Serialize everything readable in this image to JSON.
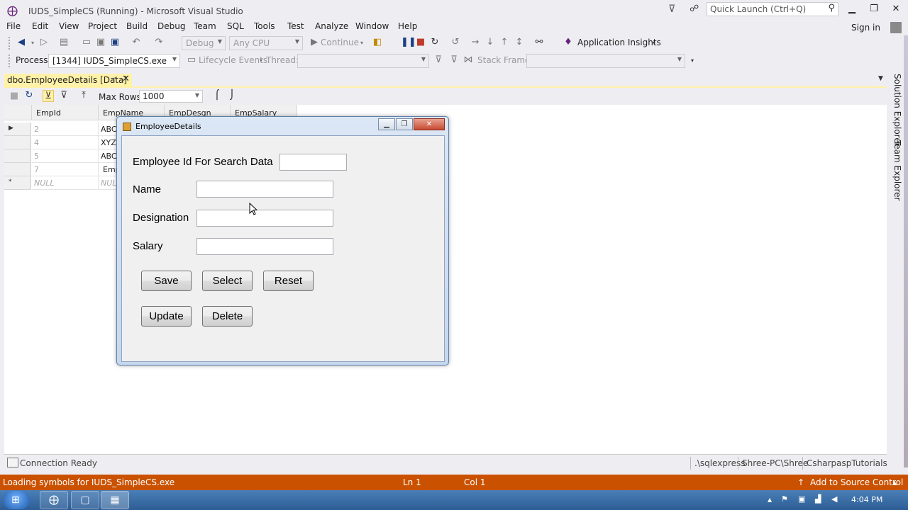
{
  "window": {
    "title": "IUDS_SimpleCS (Running) - Microsoft Visual Studio",
    "quick_launch_placeholder": "Quick Launch (Ctrl+Q)",
    "sign_in": "Sign in"
  },
  "menu": [
    "File",
    "Edit",
    "View",
    "Project",
    "Build",
    "Debug",
    "Team",
    "SQL",
    "Tools",
    "Test",
    "Analyze",
    "Window",
    "Help"
  ],
  "toolbar": {
    "config": "Debug",
    "platform": "Any CPU",
    "continue": "Continue",
    "app_insights": "Application Insights",
    "process_label": "Process:",
    "process_value": "[1344] IUDS_SimpleCS.exe",
    "lifecycle": "Lifecycle Events",
    "thread_label": "Thread:",
    "stack_frame_label": "Stack Frame:"
  },
  "document": {
    "tab_title": "dbo.EmployeeDetails [Data]",
    "max_rows_label": "Max Rows:",
    "max_rows_value": "1000"
  },
  "grid": {
    "columns": [
      "EmpId",
      "EmpName",
      "EmpDesgn",
      "EmpSalary"
    ],
    "rows": [
      {
        "marker": "▶",
        "id": "2",
        "name": "ABC"
      },
      {
        "marker": "",
        "id": "4",
        "name": "XYZ"
      },
      {
        "marker": "",
        "id": "5",
        "name": "ABC"
      },
      {
        "marker": "",
        "id": "7",
        "name": "Emp"
      },
      {
        "marker": "*",
        "id": "NULL",
        "name": "NUL"
      }
    ]
  },
  "designer_status": {
    "connection": "Connection Ready",
    "server": ".\\sqlexpress",
    "user": "Shree-PC\\Shree",
    "database": "CsharpaspTutorials"
  },
  "side_tabs": [
    "Solution Explorer",
    "Team Explorer"
  ],
  "status_bar": {
    "message": "Loading symbols for IUDS_SimpleCS.exe",
    "line": "Ln 1",
    "col": "Col 1",
    "source_control": "Add to Source Control"
  },
  "taskbar": {
    "time": "4:04 PM"
  },
  "dialog": {
    "title": "EmployeeDetails",
    "search_label": "Employee Id For Search Data",
    "search_value": "",
    "name_label": "Name",
    "name_value": "",
    "designation_label": "Designation",
    "designation_value": "",
    "salary_label": "Salary",
    "salary_value": "",
    "buttons": {
      "save": "Save",
      "select": "Select",
      "reset": "Reset",
      "update": "Update",
      "delete": "Delete"
    }
  }
}
